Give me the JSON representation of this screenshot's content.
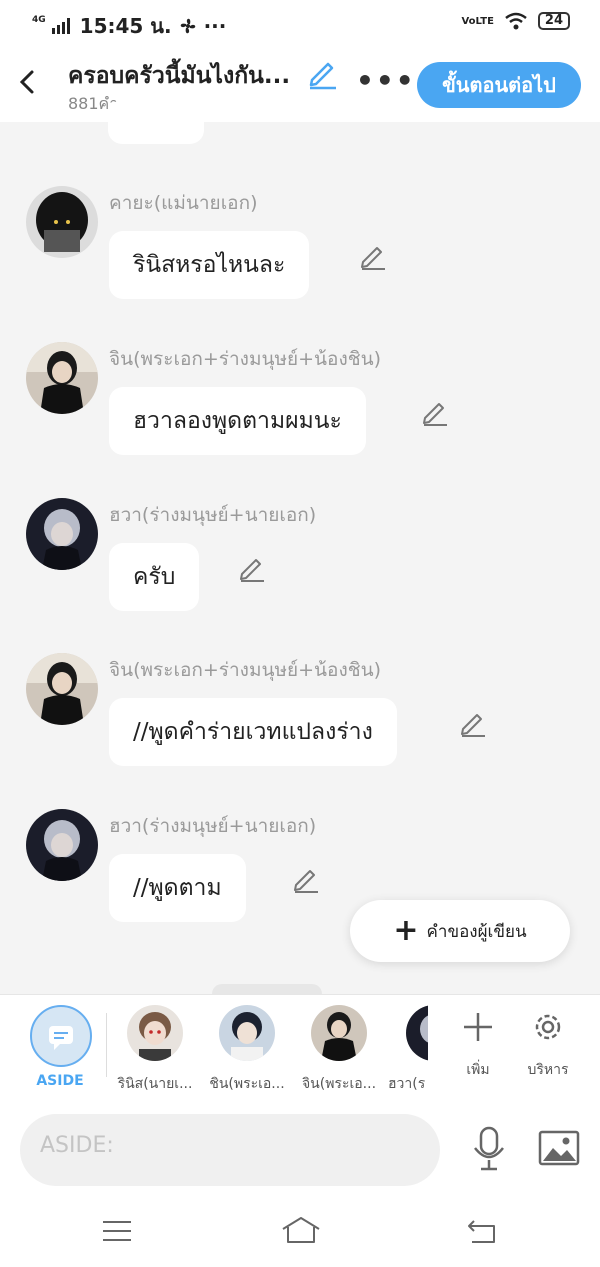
{
  "status": {
    "network": "4G",
    "time": "15:45 น.",
    "volte": "VoLTE",
    "battery": "24"
  },
  "header": {
    "title": "ครอบครัวนี้มันไงกัน...",
    "word_count": "881คำ",
    "next_button": "ขั้นตอนต่อไป"
  },
  "messages": [
    {
      "speaker": "คายะ(แม่นายเอก)",
      "text": "รินิสหรอไหนละ"
    },
    {
      "speaker": "จิน(พระเอก+ร่างมนุษย์+น้องชิน)",
      "text": "ฮวาลองพูดตามผมนะ"
    },
    {
      "speaker": "ฮวา(ร่างมนุษย์+นายเอก)",
      "text": "ครับ"
    },
    {
      "speaker": "จิน(พระเอก+ร่างมนุษย์+น้องชิน)",
      "text": "//พูดคำร่ายเวทแปลงร่าง"
    },
    {
      "speaker": "ฮวา(ร่างมนุษย์+นายเอก)",
      "text": "//พูดตาม"
    }
  ],
  "fab": {
    "label": "คำของผู้เขียน"
  },
  "character_bar": {
    "aside_label": "ASIDE",
    "characters": [
      "รินิส(นายเ...",
      "ชิน(พระเอ...",
      "จิน(พระเอ...",
      "ฮวา(ร"
    ],
    "add_label": "เพิ่ม",
    "manage_label": "บริหาร"
  },
  "input": {
    "placeholder": "ASIDE:"
  },
  "colors": {
    "accent": "#4aa6f2",
    "background": "#f4f4f4"
  }
}
